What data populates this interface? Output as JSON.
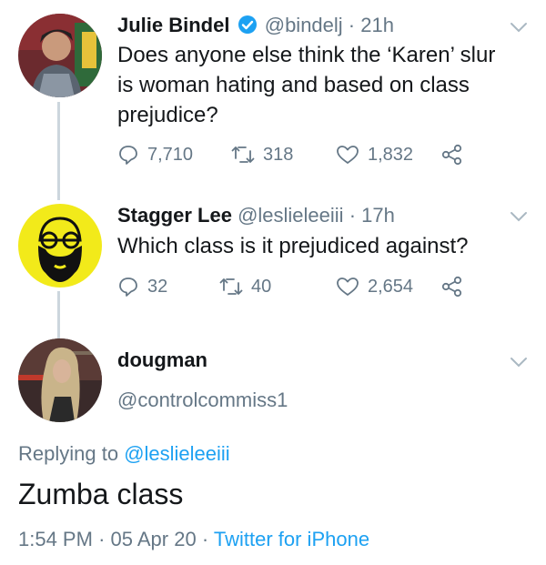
{
  "tweets": [
    {
      "name": "Julie Bindel",
      "verified": true,
      "handle": "@bindelj",
      "separator": "·",
      "time": "21h",
      "text_lines": [
        "Does anyone else think the ‘Karen’ slur",
        "is woman hating and based on class",
        "prejudice?"
      ],
      "replies": "7,710",
      "retweets": "318",
      "likes": "1,832",
      "icons": [
        "reply-icon",
        "retweet-icon",
        "like-icon",
        "share-icon",
        "chevron-down-icon",
        "verified-badge-icon"
      ]
    },
    {
      "name": "Stagger Lee",
      "handle": "@leslieleeiii",
      "separator": "·",
      "time": "17h",
      "text_lines": [
        "Which class is it prejudiced against?"
      ],
      "replies": "32",
      "retweets": "40",
      "likes": "2,654"
    }
  ],
  "main": {
    "name": "dougman",
    "handle": "@controlcommiss1",
    "replying_prefix": "Replying to",
    "replying_handle": "@leslieleeiii",
    "text": "Zumba class",
    "time": "1:54 PM",
    "separator": "·",
    "date": "05 Apr 20",
    "source": "Twitter for iPhone"
  },
  "colors": {
    "accent": "#1da1f2",
    "muted": "#657786",
    "thread_line": "#ccd6dd",
    "text": "#14171a"
  }
}
